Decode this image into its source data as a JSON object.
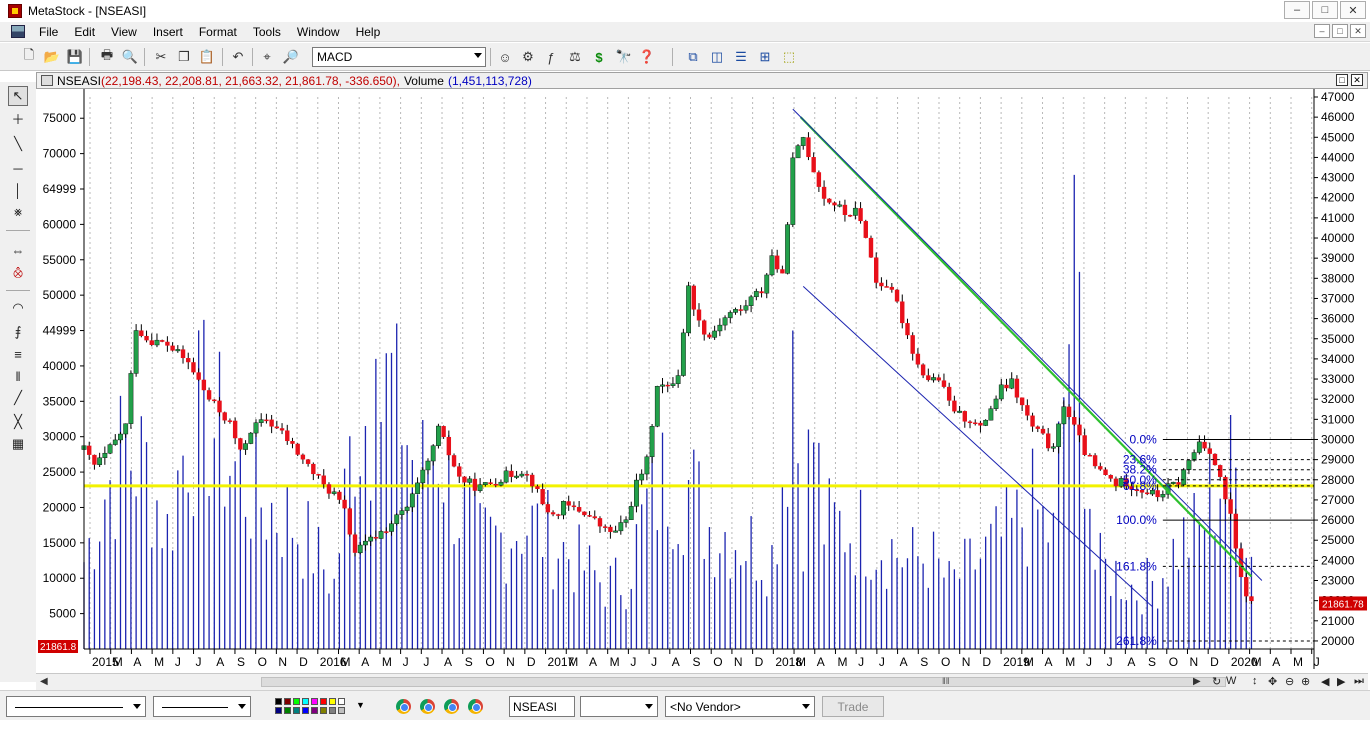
{
  "window": {
    "title": "MetaStock - [NSEASI]",
    "controls": [
      "–",
      "□",
      "✕"
    ]
  },
  "menu": {
    "items": [
      "File",
      "Edit",
      "View",
      "Insert",
      "Format",
      "Tools",
      "Window",
      "Help"
    ],
    "mdi_controls": [
      "–",
      "□",
      "✕"
    ]
  },
  "toolbar": {
    "indicator_combo": "MACD"
  },
  "chart_header": {
    "symbol": "NSEASI",
    "ohlc_text": "(22,198.43, 22,208.81, 21,663.32, 21,861.78, -336.650),",
    "volume_label": "Volume",
    "volume_value": "(1,451,113,728)"
  },
  "colors": {
    "up_candle": "#22a04a",
    "down_candle": "#e8101a",
    "volume_bar": "#1c24b0",
    "horizontal_line": "#f2f200",
    "trend_green": "#2ec02e",
    "channel_blue": "#1c24b0",
    "last_price_bg": "#d00000",
    "fib_label": "#0000c0"
  },
  "bottom_bar": {
    "symbol_box": "NSEASI",
    "vendor_combo": "<No Vendor>",
    "trade_button": "Trade"
  },
  "scrollbar": {
    "controls": [
      "↻",
      "W",
      "↕",
      "✥",
      "⊖",
      "⊕"
    ]
  },
  "chart_data": {
    "type": "candlestick",
    "volume_axis_ticks": [
      "75000",
      "70000",
      "64999",
      "60000",
      "55000",
      "50000",
      "44999",
      "40000",
      "35000",
      "30000",
      "25000",
      "20000",
      "15000",
      "10000",
      "5000"
    ],
    "price_axis_ticks": [
      "47000",
      "46000",
      "45000",
      "44000",
      "43000",
      "42000",
      "41000",
      "40000",
      "39000",
      "38000",
      "37000",
      "36000",
      "35000",
      "34000",
      "33000",
      "32000",
      "31000",
      "30000",
      "29000",
      "28000",
      "27000",
      "26000",
      "25000",
      "24000",
      "23000",
      "22000",
      "21000",
      "20000"
    ],
    "x_ticks": [
      "2015",
      "M",
      "A",
      "M",
      "J",
      "J",
      "A",
      "S",
      "O",
      "N",
      "D",
      "2016",
      "M",
      "A",
      "M",
      "J",
      "J",
      "A",
      "S",
      "O",
      "N",
      "D",
      "2017",
      "M",
      "A",
      "M",
      "J",
      "J",
      "A",
      "S",
      "O",
      "N",
      "D",
      "2018",
      "M",
      "A",
      "M",
      "J",
      "J",
      "A",
      "S",
      "O",
      "N",
      "D",
      "2019",
      "M",
      "A",
      "M",
      "J",
      "J",
      "A",
      "S",
      "O",
      "N",
      "D",
      "2020",
      "M",
      "A",
      "M",
      "J"
    ],
    "last_price_label": "21861.78",
    "left_last_label": "21861.8",
    "fibonacci_levels": [
      {
        "label": "0.0%",
        "price": 30000
      },
      {
        "label": "23.6%",
        "price": 29000
      },
      {
        "label": "38.2%",
        "price": 28500
      },
      {
        "label": "50.0%",
        "price": 28000
      },
      {
        "label": "61.8%",
        "price": 27700
      },
      {
        "label": "100.0%",
        "price": 26000
      },
      {
        "label": "161.8%",
        "price": 23700
      },
      {
        "label": "261.8%",
        "price": 20000
      }
    ],
    "horizontal_line_price": 27700,
    "price_path": [
      [
        0,
        29500
      ],
      [
        2,
        28700
      ],
      [
        4,
        29200
      ],
      [
        6,
        29900
      ],
      [
        8,
        30700
      ],
      [
        10,
        35600
      ],
      [
        12,
        35000
      ],
      [
        16,
        34700
      ],
      [
        20,
        33800
      ],
      [
        24,
        32000
      ],
      [
        28,
        30800
      ],
      [
        30,
        29300
      ],
      [
        32,
        30500
      ],
      [
        35,
        31000
      ],
      [
        38,
        30300
      ],
      [
        42,
        29000
      ],
      [
        46,
        27700
      ],
      [
        48,
        27300
      ],
      [
        50,
        26400
      ],
      [
        52,
        24400
      ],
      [
        54,
        24800
      ],
      [
        58,
        25600
      ],
      [
        62,
        26600
      ],
      [
        66,
        28800
      ],
      [
        68,
        30500
      ],
      [
        70,
        29300
      ],
      [
        72,
        28100
      ],
      [
        74,
        27800
      ],
      [
        76,
        27600
      ],
      [
        80,
        28100
      ],
      [
        84,
        28500
      ],
      [
        86,
        27900
      ],
      [
        88,
        26800
      ],
      [
        90,
        26200
      ],
      [
        92,
        26700
      ],
      [
        96,
        26400
      ],
      [
        100,
        25500
      ],
      [
        102,
        25400
      ],
      [
        104,
        26000
      ],
      [
        106,
        27800
      ],
      [
        108,
        28900
      ],
      [
        110,
        32800
      ],
      [
        112,
        32500
      ],
      [
        114,
        33300
      ],
      [
        116,
        37500
      ],
      [
        118,
        35800
      ],
      [
        120,
        35100
      ],
      [
        122,
        35800
      ],
      [
        124,
        36300
      ],
      [
        126,
        36400
      ],
      [
        128,
        37000
      ],
      [
        130,
        37400
      ],
      [
        132,
        39100
      ],
      [
        134,
        38000
      ],
      [
        136,
        43800
      ],
      [
        138,
        45000
      ],
      [
        140,
        43400
      ],
      [
        142,
        42000
      ],
      [
        144,
        41700
      ],
      [
        146,
        41200
      ],
      [
        148,
        41300
      ],
      [
        150,
        40200
      ],
      [
        152,
        37800
      ],
      [
        154,
        37700
      ],
      [
        156,
        36700
      ],
      [
        158,
        35200
      ],
      [
        160,
        33700
      ],
      [
        162,
        33000
      ],
      [
        164,
        33000
      ],
      [
        166,
        31800
      ],
      [
        168,
        31200
      ],
      [
        170,
        31000
      ],
      [
        172,
        30500
      ],
      [
        174,
        31600
      ],
      [
        176,
        32500
      ],
      [
        178,
        32800
      ],
      [
        180,
        31600
      ],
      [
        182,
        30600
      ],
      [
        184,
        30100
      ],
      [
        186,
        29400
      ],
      [
        188,
        31800
      ],
      [
        190,
        30600
      ],
      [
        192,
        29400
      ],
      [
        194,
        28600
      ],
      [
        196,
        28200
      ],
      [
        198,
        27800
      ],
      [
        200,
        27900
      ],
      [
        202,
        27600
      ],
      [
        204,
        27400
      ],
      [
        206,
        27200
      ],
      [
        208,
        27600
      ],
      [
        210,
        27900
      ],
      [
        212,
        28900
      ],
      [
        214,
        29900
      ],
      [
        216,
        29500
      ],
      [
        218,
        28000
      ],
      [
        220,
        26100
      ],
      [
        222,
        23000
      ],
      [
        224,
        21800
      ]
    ],
    "volume_bars": [
      [
        0,
        15000
      ],
      [
        4,
        27000
      ],
      [
        8,
        34000
      ],
      [
        12,
        31000
      ],
      [
        16,
        20000
      ],
      [
        20,
        38000
      ],
      [
        24,
        40000
      ],
      [
        28,
        32000
      ],
      [
        32,
        27000
      ],
      [
        36,
        24000
      ],
      [
        40,
        22000
      ],
      [
        44,
        17000
      ],
      [
        48,
        11000
      ],
      [
        52,
        39000
      ],
      [
        56,
        41000
      ],
      [
        60,
        46000
      ],
      [
        64,
        28000
      ],
      [
        68,
        36000
      ],
      [
        72,
        24000
      ],
      [
        76,
        18000
      ],
      [
        80,
        19000
      ],
      [
        84,
        22000
      ],
      [
        88,
        20000
      ],
      [
        92,
        17000
      ],
      [
        96,
        14000
      ],
      [
        100,
        11000
      ],
      [
        104,
        12000
      ],
      [
        108,
        24000
      ],
      [
        112,
        30000
      ],
      [
        116,
        28000
      ],
      [
        120,
        21000
      ],
      [
        124,
        20000
      ],
      [
        128,
        18000
      ],
      [
        132,
        16000
      ],
      [
        136,
        45000
      ],
      [
        138,
        24000
      ],
      [
        140,
        37000
      ],
      [
        142,
        21000
      ],
      [
        146,
        21000
      ],
      [
        150,
        20000
      ],
      [
        154,
        18000
      ],
      [
        158,
        15000
      ],
      [
        162,
        16000
      ],
      [
        166,
        11000
      ],
      [
        170,
        14000
      ],
      [
        174,
        17000
      ],
      [
        178,
        20000
      ],
      [
        182,
        24000
      ],
      [
        186,
        19000
      ],
      [
        190,
        67000
      ],
      [
        194,
        14000
      ],
      [
        198,
        13000
      ],
      [
        202,
        10000
      ],
      [
        206,
        12000
      ],
      [
        210,
        18000
      ],
      [
        214,
        20000
      ],
      [
        218,
        30000
      ],
      [
        222,
        29000
      ],
      [
        224,
        16000
      ]
    ]
  }
}
